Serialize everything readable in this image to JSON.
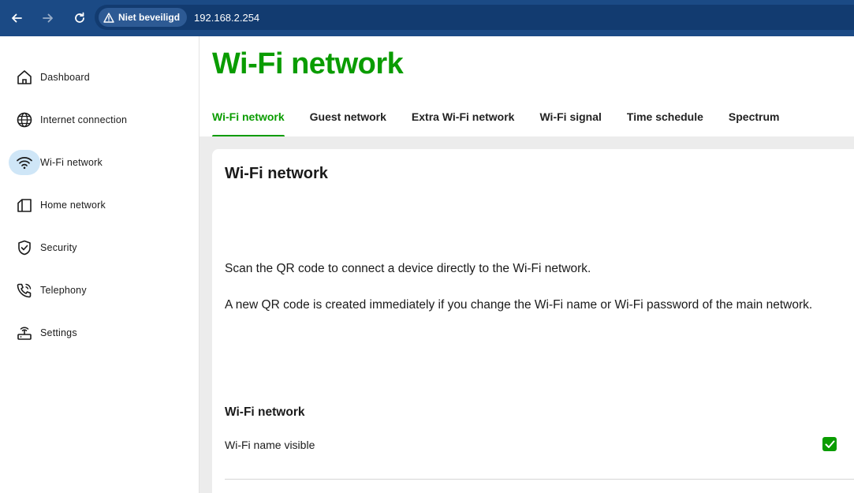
{
  "browser": {
    "security_label": "Niet beveiligd",
    "url": "192.168.2.254"
  },
  "sidebar": {
    "items": [
      {
        "label": "Dashboard",
        "icon": "home-icon",
        "active": false
      },
      {
        "label": "Internet connection",
        "icon": "globe-icon",
        "active": false
      },
      {
        "label": "Wi-Fi network",
        "icon": "wifi-icon",
        "active": true
      },
      {
        "label": "Home network",
        "icon": "home-network-icon",
        "active": false
      },
      {
        "label": "Security",
        "icon": "shield-icon",
        "active": false
      },
      {
        "label": "Telephony",
        "icon": "phone-icon",
        "active": false
      },
      {
        "label": "Settings",
        "icon": "router-icon",
        "active": false
      }
    ]
  },
  "main": {
    "title": "Wi-Fi network",
    "tabs": [
      {
        "label": "Wi-Fi network",
        "active": true
      },
      {
        "label": "Guest network",
        "active": false
      },
      {
        "label": "Extra Wi-Fi network",
        "active": false
      },
      {
        "label": "Wi-Fi signal",
        "active": false
      },
      {
        "label": "Time schedule",
        "active": false
      },
      {
        "label": "Spectrum",
        "active": false
      }
    ],
    "card": {
      "title": "Wi-Fi network",
      "text1": "Scan the QR code to connect a device directly to the Wi-Fi network.",
      "text2": "A new QR code is created immediately if you change the Wi-Fi name or Wi-Fi password of the main network.",
      "section_title": "Wi-Fi network",
      "setting_label": "Wi-Fi name visible",
      "setting_checked": true
    }
  },
  "colors": {
    "brand_green": "#0a9c00",
    "browser_bar": "#1b4a85",
    "active_icon_bg": "#cfe6f7"
  }
}
